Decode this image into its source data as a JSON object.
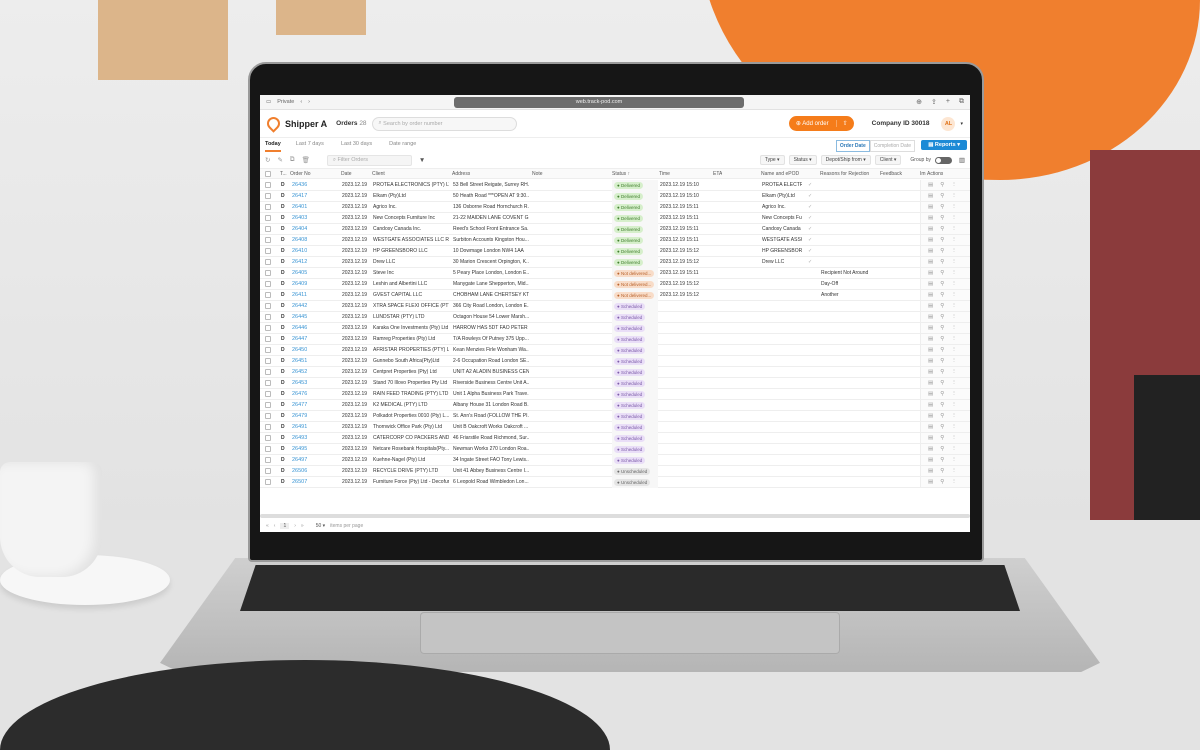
{
  "browser": {
    "mode": "Private",
    "url": "web.track-pod.com"
  },
  "app": {
    "brand": "Shipper A",
    "orders_label": "Orders",
    "orders_count": "28",
    "search_placeholder": "Search by order number",
    "add_order": "Add order",
    "company": "Company ID 30018",
    "avatar": "AL",
    "accent": "#f07f2e"
  },
  "tabs": [
    "Today",
    "Last 7 days",
    "Last 30 days",
    "Date range"
  ],
  "date_switch": [
    "Order Date",
    "Completion Date"
  ],
  "reports": "Reports",
  "toolbar": {
    "filter_placeholder": "Filter Orders",
    "filters": [
      "Type",
      "Status",
      "Depot/Ship from",
      "Client"
    ],
    "group_by": "Group by"
  },
  "columns": [
    "T...",
    "Order No",
    "Date",
    "Client",
    "Address",
    "Note",
    "Status ↑",
    "Time",
    "ETA",
    "Name and ePOD",
    "Reasons for Rejection",
    "Feedback",
    "Im",
    "Actions"
  ],
  "status_colors": {
    "Delivered": [
      "#d6efcb",
      "#3f7d2c"
    ],
    "Not delivered...": [
      "#f8dcc8",
      "#b8612a"
    ],
    "Scheduled": [
      "#e9def7",
      "#7b5aa8"
    ],
    "Unscheduled": [
      "#e4e4e4",
      "#666666"
    ]
  },
  "rows": [
    {
      "type": "D",
      "no": "26436",
      "date": "2023.12.19",
      "client": "PROTEA ELECTRONICS (PTY) LTD",
      "address": "53 Bell Street Reigate, Surrey RH...",
      "status": "Delivered",
      "time": "2023.12.19 15:10",
      "name": "PROTEA ELECTR...",
      "reason": ""
    },
    {
      "type": "D",
      "no": "26417",
      "date": "2023.12.19",
      "client": "Elkam (Pty)Ltd",
      "address": "50 Heath Road ***OPEN AT 9:30...",
      "status": "Delivered",
      "time": "2023.12.19 15:10",
      "name": "Elkam (Pty)Ltd",
      "reason": ""
    },
    {
      "type": "D",
      "no": "26401",
      "date": "2023.12.19",
      "client": "Agrico Inc.",
      "address": "136 Osborne Road Hornchurch R...",
      "status": "Delivered",
      "time": "2023.12.19 15:11",
      "name": "Agrico Inc.",
      "reason": ""
    },
    {
      "type": "D",
      "no": "26403",
      "date": "2023.12.19",
      "client": "New Concepts Furniture Inc",
      "address": "21-22 MAIDEN LANE COVENT G...",
      "status": "Delivered",
      "time": "2023.12.19 15:11",
      "name": "New Concepts Fur...",
      "reason": ""
    },
    {
      "type": "D",
      "no": "26404",
      "date": "2023.12.19",
      "client": "Candosy Canada Inc.",
      "address": "Reed's School Front Entrance Sa...",
      "status": "Delivered",
      "time": "2023.12.19 15:11",
      "name": "Candosy Canada I...",
      "reason": ""
    },
    {
      "type": "D",
      "no": "26408",
      "date": "2023.12.19",
      "client": "WESTGATE ASSOCIATES LLC R",
      "address": "Surbiton Accounts Kingston Hou...",
      "status": "Delivered",
      "time": "2023.12.19 15:11",
      "name": "WESTGATE ASSO...",
      "reason": ""
    },
    {
      "type": "D",
      "no": "26410",
      "date": "2023.12.19",
      "client": "HP GREENSBORO LLC",
      "address": "10 Dowmage London NW4 1AA",
      "status": "Delivered",
      "time": "2023.12.19 15:12",
      "name": "HP GREENSBORO...",
      "reason": ""
    },
    {
      "type": "D",
      "no": "26412",
      "date": "2023.12.19",
      "client": "Drew LLC",
      "address": "30 Marion Crescent Orpington, K...",
      "status": "Delivered",
      "time": "2023.12.19 15:12",
      "name": "Drew LLC",
      "reason": ""
    },
    {
      "type": "D",
      "no": "26405",
      "date": "2023.12.19",
      "client": "Steve Inc",
      "address": "5 Peary Place London, London E...",
      "status": "Not delivered...",
      "time": "2023.12.19 15:11",
      "name": "",
      "reason": "Recipient Not Around"
    },
    {
      "type": "D",
      "no": "26409",
      "date": "2023.12.19",
      "client": "Leshin and Albertini LLC",
      "address": "Manygate Lane Shepperton, Mid...",
      "status": "Not delivered...",
      "time": "2023.12.19 15:12",
      "name": "",
      "reason": "Day-Off"
    },
    {
      "type": "D",
      "no": "26411",
      "date": "2023.12.19",
      "client": "GVEST CAPITAL LLC",
      "address": "CHOBHAM LANE CHERTSEY KT...",
      "status": "Not delivered...",
      "time": "2023.12.19 15:12",
      "name": "",
      "reason": "Another"
    },
    {
      "type": "D",
      "no": "26442",
      "date": "2023.12.19",
      "client": "XTRA SPACE FLEXI OFFICE (PTY...",
      "address": "366 City Road London, London E...",
      "status": "Scheduled",
      "time": "",
      "name": "",
      "reason": ""
    },
    {
      "type": "D",
      "no": "26445",
      "date": "2023.12.19",
      "client": "LUNDSTAR (PTY) LTD",
      "address": "Octagon House 54 Lower Marsh...",
      "status": "Scheduled",
      "time": "",
      "name": "",
      "reason": ""
    },
    {
      "type": "D",
      "no": "26446",
      "date": "2023.12.19",
      "client": "Karaka One Investments (Pty) Ltd",
      "address": "HARROW HAS 5DT FAO PETER S...",
      "status": "Scheduled",
      "time": "",
      "name": "",
      "reason": ""
    },
    {
      "type": "D",
      "no": "26447",
      "date": "2023.12.19",
      "client": "Ramreg Properties (Pty) Ltd",
      "address": "T/A Rowleys Of Putney 375 Upp...",
      "status": "Scheduled",
      "time": "",
      "name": "",
      "reason": ""
    },
    {
      "type": "D",
      "no": "26450",
      "date": "2023.12.19",
      "client": "AFRISTAR PROPERTIES (PTY) LTD",
      "address": "Kean Menzies Firle Wonham Wa...",
      "status": "Scheduled",
      "time": "",
      "name": "",
      "reason": ""
    },
    {
      "type": "D",
      "no": "26451",
      "date": "2023.12.19",
      "client": "Gunnebo South Africa(Pty)Ltd",
      "address": "2-6 Occupation Road London SE...",
      "status": "Scheduled",
      "time": "",
      "name": "",
      "reason": ""
    },
    {
      "type": "D",
      "no": "26452",
      "date": "2023.12.19",
      "client": "Centpret Properties (Pty) Ltd",
      "address": "UNIT A2 ALADIN BUSINESS CEN...",
      "status": "Scheduled",
      "time": "",
      "name": "",
      "reason": ""
    },
    {
      "type": "D",
      "no": "26453",
      "date": "2023.12.19",
      "client": "Stand 70 Illovo Properties Pty Ltd",
      "address": "Riverside Business Centre Unit A...",
      "status": "Scheduled",
      "time": "",
      "name": "",
      "reason": ""
    },
    {
      "type": "D",
      "no": "26476",
      "date": "2023.12.19",
      "client": "RAIN FEED TRADING (PTY) LTD",
      "address": "Unit 1 Alpha Business Park Trave...",
      "status": "Scheduled",
      "time": "",
      "name": "",
      "reason": ""
    },
    {
      "type": "D",
      "no": "26477",
      "date": "2023.12.19",
      "client": "K2 MEDICAL (PTY) LTD",
      "address": "Albany House 31 London Road B...",
      "status": "Scheduled",
      "time": "",
      "name": "",
      "reason": ""
    },
    {
      "type": "D",
      "no": "26479",
      "date": "2023.12.19",
      "client": "Polkadot Properties 0010 (Pty) L...",
      "address": "St. Ann's Road (FOLLOW THE PI...",
      "status": "Scheduled",
      "time": "",
      "name": "",
      "reason": ""
    },
    {
      "type": "D",
      "no": "26491",
      "date": "2023.12.19",
      "client": "Thornwick Office Park (Pty) Ltd",
      "address": "Unit B Oakcroft Works Oakcroft ...",
      "status": "Scheduled",
      "time": "",
      "name": "",
      "reason": ""
    },
    {
      "type": "D",
      "no": "26493",
      "date": "2023.12.19",
      "client": "CATERCORP CO PACKERS AND ...",
      "address": "46 Friarstile Road Richmond, Sur...",
      "status": "Scheduled",
      "time": "",
      "name": "",
      "reason": ""
    },
    {
      "type": "D",
      "no": "26495",
      "date": "2023.12.19",
      "client": "Netcare Rosebank Hospitals(Pty...",
      "address": "Newman Works 270 London Roa...",
      "status": "Scheduled",
      "time": "",
      "name": "",
      "reason": ""
    },
    {
      "type": "D",
      "no": "26497",
      "date": "2023.12.19",
      "client": "Kuehne-Nagel (Pty) Ltd",
      "address": "34 Ingate Street FAO Tony Lewis...",
      "status": "Scheduled",
      "time": "",
      "name": "",
      "reason": ""
    },
    {
      "type": "D",
      "no": "26506",
      "date": "2023.12.19",
      "client": "RECYCLE DRIVE (PTY) LTD",
      "address": "Unit 41 Abbey Business Centre I...",
      "status": "Unscheduled",
      "time": "",
      "name": "",
      "reason": ""
    },
    {
      "type": "D",
      "no": "26507",
      "date": "2023.12.19",
      "client": "Furniture Force (Pty) Ltd - Decofur",
      "address": "6 Leopold Road Wimbledon Lon...",
      "status": "Unscheduled",
      "time": "",
      "name": "",
      "reason": ""
    }
  ],
  "footer": {
    "page": "1",
    "per_page": "50",
    "per_page_label": "items per page"
  }
}
